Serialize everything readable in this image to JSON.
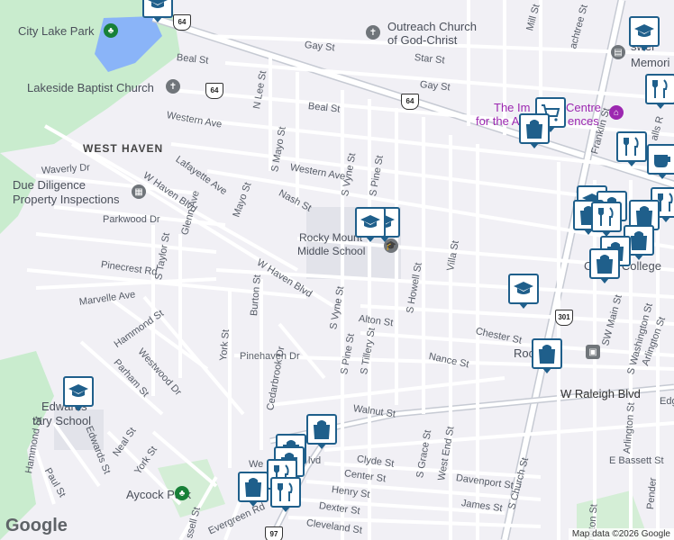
{
  "map": {
    "areas": {
      "west_haven": "WEST HAVEN"
    },
    "pois": {
      "city_lake_park": "City Lake Park",
      "outreach_church_1": "Outreach Church",
      "outreach_church_2": "of God-Christ",
      "lakeside_baptist": "Lakeside Baptist Church",
      "due_diligence_1": "Due Diligence",
      "due_diligence_2": "Property Inspections",
      "rocky_mount_middle_1": "Rocky Mount",
      "rocky_mount_middle_2": "Middle School",
      "imperial_centre_1": "The Im",
      "imperial_centre_2": "Centre",
      "imperial_centre_3": "for the A",
      "imperial_centre_4": "ences",
      "community_college": "Comm        College",
      "aycock_park": "Aycock Park",
      "edwards_school_1": "Edwards",
      "edwards_school_2": "tary School",
      "roc_station": "Roc   unt",
      "memori": "Memori",
      "bosw": "swel"
    },
    "streets": {
      "gay_st_1": "Gay St",
      "gay_st_2": "Gay St",
      "star_st": "Star St",
      "beal_st_1": "Beal St",
      "beal_st_2": "Beal St",
      "western_ave_1": "Western Ave",
      "western_ave_2": "Western Ave",
      "n_lee_st": "N Lee St",
      "s_mayo_st": "S Mayo St",
      "nash_st": "Nash St",
      "s_vyne_st_1": "S Vyne St",
      "s_vyne_st_2": "S Vyne St",
      "s_pine_st_1": "S Pine St",
      "s_pine_st_2": "S Pine St",
      "lafayette_ave": "Lafayette Ave",
      "waverly_dr": "Waverly Dr",
      "w_haven_blvd_1": "W Haven Blvd",
      "w_haven_blvd_2": "W Haven Blvd",
      "glenn_ave": "Glenn Ave",
      "mayo_st": "Mayo St",
      "parkwood_dr": "Parkwood Dr",
      "s_taylor_st": "S Taylor St",
      "pinecrest_rd": "Pinecrest Rd",
      "marvelle_ave": "Marvelle Ave",
      "hammond_st_1": "Hammond St",
      "hammond_st_2": "Hammond St",
      "westwood_dr": "Westwood Dr",
      "parham_st": "Parham St",
      "burton_st": "Burton St",
      "york_st_1": "York St",
      "york_st_2": "York St",
      "pinehaven_dr": "Pinehaven Dr",
      "cedarbrook_dr": "Cedarbrook Dr",
      "alton_st": "Alton St",
      "s_tillery_st": "S Tillery St",
      "s_howell_st": "S Howell St",
      "villa_st": "Villa St",
      "chester_st": "Chester St",
      "nance_st": "Nance St",
      "w_raleigh_blvd": "W Raleigh Blvd",
      "walnut_st": "Walnut St",
      "edwards_st": "Edwards St",
      "neal_st": "Neal St",
      "paul_st": "Paul St",
      "clyde_st": "Clyde St",
      "center_st": "Center St",
      "henry_st": "Henry St",
      "dexter_st": "Dexter St",
      "cleveland_st": "Cleveland St",
      "evergreen_rd": "Evergreen Rd",
      "russell_st": "ssell St",
      "s_grace_st": "S Grace St",
      "west_end_st": "West End St",
      "davenport_st": "Davenport St",
      "james_st": "James St",
      "s_church_st": "S Church St",
      "franklin_st": "Franklin St",
      "sw_main_st": "SW Main St",
      "s_washington_st": "S Washington St",
      "arlington_st_1": "Arlington St",
      "arlington_st_2": "Arlington St",
      "arlington_st_3": "ngton St",
      "e_bassett_st": "E Bassett St",
      "peachtree_st": "achtree St",
      "mill_st": "Mill St",
      "falls_rd": "alls R",
      "pender": "Pender",
      "edge": "Edg",
      "we": "We",
      "lvd": "lvd"
    },
    "shields": {
      "bus_64_a": "64",
      "bus_64_b": "64",
      "bus_64_c": "64",
      "bus_301": "301",
      "us_97": "97"
    },
    "attribution": {
      "google": "Google",
      "copyright": "Map data ©2026 Google"
    },
    "colors": {
      "marker_border": "#1f5f8b",
      "park": "#c9ecce",
      "water": "#8ab4f8",
      "road": "#ffffff",
      "highway": "#c6cad3"
    }
  }
}
